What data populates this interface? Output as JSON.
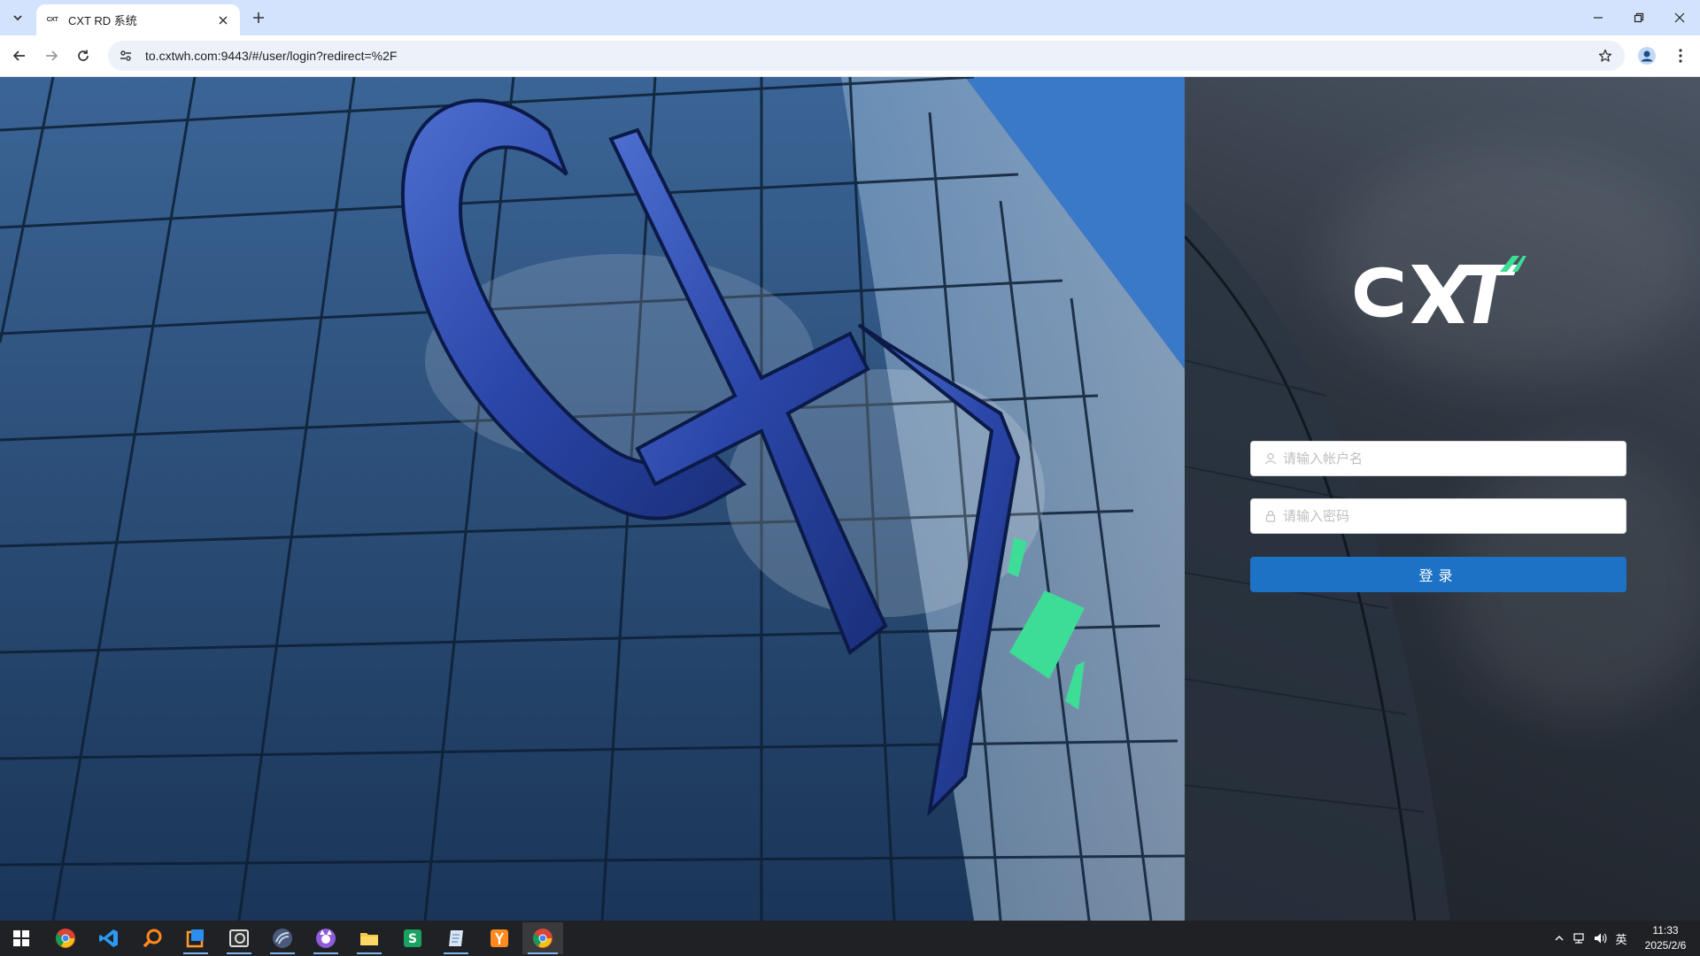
{
  "browser": {
    "tab": {
      "favicon_text": "CXT",
      "title": "CXT RD 系统"
    },
    "address_bar": {
      "url": "to.cxtwh.com:9443/#/user/login?redirect=%2F"
    }
  },
  "login": {
    "logo_text": "CXT",
    "username_placeholder": "请输入帐户名",
    "password_placeholder": "请输入密码",
    "submit_label": "登录"
  },
  "taskbar": {
    "apps": [
      "start",
      "chrome",
      "vscode",
      "search-app",
      "window-app",
      "terminal-app",
      "network-app",
      "cat-app",
      "file-explorer",
      "wps-sheets",
      "notes-app",
      "yandex-app",
      "chrome-active"
    ],
    "clock": {
      "time": "11:33",
      "date": "2025/2/6"
    },
    "ime": "英"
  },
  "colors": {
    "accent": "#1c72c4",
    "brand_green": "#3ddc97",
    "brand_blue": "#1e3a8a"
  }
}
